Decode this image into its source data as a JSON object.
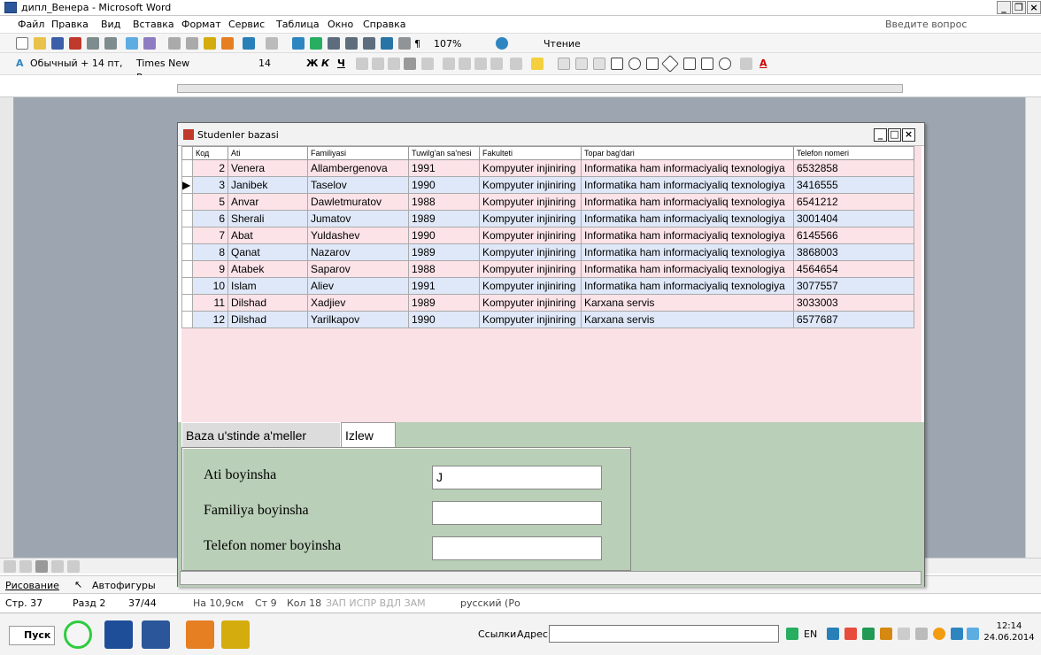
{
  "word": {
    "title": "дипл_Венера - Microsoft Word",
    "menu": [
      "Файл",
      "Правка",
      "Вид",
      "Вставка",
      "Формат",
      "Сервис",
      "Таблица",
      "Окно",
      "Справка"
    ],
    "ask_question": "Введите вопрос",
    "zoom": "107%",
    "reading": "Чтение",
    "style": "Обычный + 14 пт,",
    "font": "Times New Roman",
    "font_size": "14",
    "bold": "Ж",
    "italic": "К",
    "underline": "Ч",
    "drawing": "Рисование",
    "autoshapes": "Автофигуры",
    "status": {
      "page": "Стр. 37",
      "section": "Разд 2",
      "pages": "37/44",
      "at": "На 10,9см",
      "line": "Ст 9",
      "col": "Кол 18",
      "flags": "ЗАП  ИСПР  ВДЛ  ЗАМ",
      "lang": "русский (Ро"
    }
  },
  "access": {
    "title": "Studenler bazasi",
    "columns": [
      "Код",
      "Ati",
      "Familiyasi",
      "Tuwilg'an sa'nesi",
      "Fakulteti",
      "Topar bag'dari",
      "Telefon nomeri"
    ],
    "rows": [
      [
        "2",
        "Venera",
        "Allambergenova",
        "1991",
        "Kompyuter injiniring",
        "Informatika ham informaciyaliq texnologiya",
        "6532858"
      ],
      [
        "3",
        "Janibek",
        "Taselov",
        "1990",
        "Kompyuter injiniring",
        "Informatika ham informaciyaliq texnologiya",
        "3416555"
      ],
      [
        "5",
        "Anvar",
        "Dawletmuratov",
        "1988",
        "Kompyuter injiniring",
        "Informatika ham informaciyaliq texnologiya",
        "6541212"
      ],
      [
        "6",
        "Sherali",
        "Jumatov",
        "1989",
        "Kompyuter injiniring",
        "Informatika ham informaciyaliq texnologiya",
        "3001404"
      ],
      [
        "7",
        "Abat",
        "Yuldashev",
        "1990",
        "Kompyuter injiniring",
        "Informatika ham informaciyaliq texnologiya",
        "6145566"
      ],
      [
        "8",
        "Qanat",
        "Nazarov",
        "1989",
        "Kompyuter injiniring",
        "Informatika ham informaciyaliq texnologiya",
        "3868003"
      ],
      [
        "9",
        "Atabek",
        "Saparov",
        "1988",
        "Kompyuter injiniring",
        "Informatika ham informaciyaliq texnologiya",
        "4564654"
      ],
      [
        "10",
        "Islam",
        "Aliev",
        "1991",
        "Kompyuter injiniring",
        "Informatika ham informaciyaliq texnologiya",
        "3077557"
      ],
      [
        "11",
        "Dilshad",
        "Xadjiev",
        "1989",
        "Kompyuter injiniring",
        "Karxana servis",
        "3033003"
      ],
      [
        "12",
        "Dilshad",
        "Yarilkapov",
        "1990",
        "Kompyuter injiniring",
        "Karxana servis",
        "6577687"
      ]
    ],
    "tabs": {
      "tab1": "Baza u'stinde a'meller",
      "tab2": "Izlew"
    },
    "fields": {
      "ati_label": "Ati boyinsha",
      "ati_value": "J",
      "familiya_label": "Familiya boyinsha",
      "familiya_value": "",
      "telefon_label": "Telefon nomer boyinsha",
      "telefon_value": ""
    }
  },
  "taskbar": {
    "start": "Пуск",
    "links": "Ссылки",
    "address": "Адрес",
    "lang": "EN",
    "time": "12:14",
    "date": "24.06.2014"
  }
}
